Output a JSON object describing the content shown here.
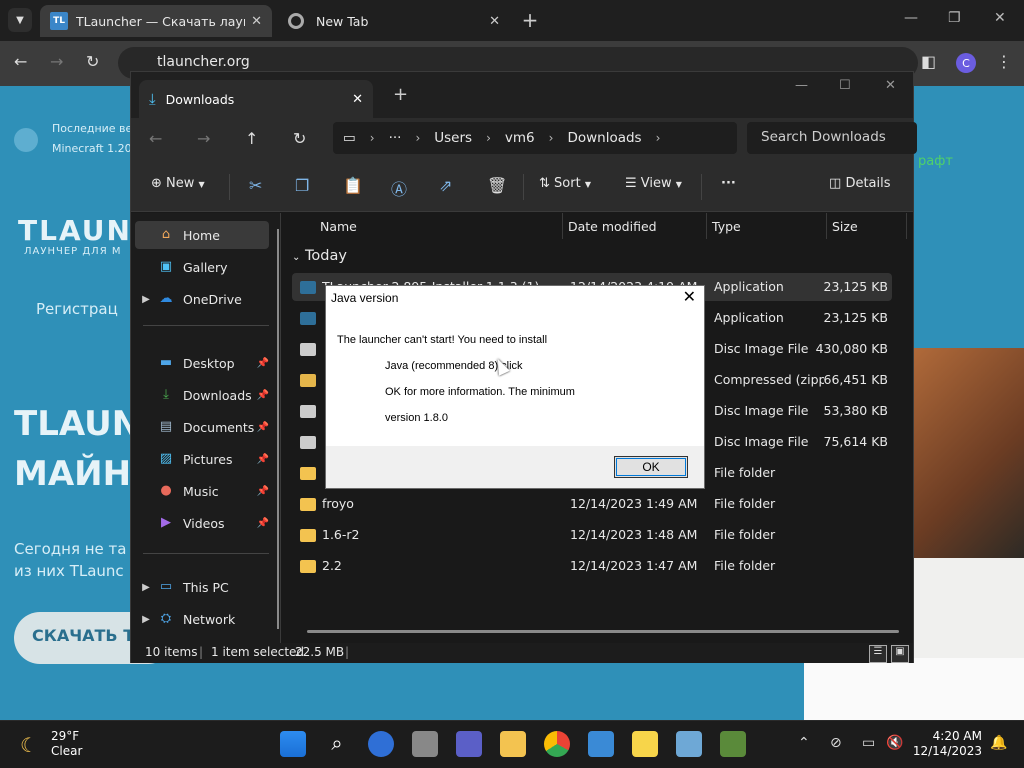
{
  "browser": {
    "tabs": [
      {
        "title": "TLauncher — Скачать лаунчер",
        "favicon": "TL",
        "active": true
      },
      {
        "title": "New Tab",
        "active": false
      }
    ],
    "url": "tlauncher.org",
    "profile_initial": "C"
  },
  "website": {
    "note_line1": "Последние ве",
    "note_line2": "Minecraft 1.20",
    "logo": "TLAUNC",
    "logo_sub": "ЛАУНЧЕР ДЛЯ М",
    "register": "Регистрац",
    "heading1": "TLAUN",
    "heading2": "МАЙН",
    "para1": "Сегодня не та",
    "para2": "из них TLaunc",
    "download_button": "СКАЧАТЬ Т",
    "right_label": "рафт"
  },
  "explorer": {
    "tab_title": "Downloads",
    "breadcrumb": [
      "Users",
      "vm6",
      "Downloads"
    ],
    "search_placeholder": "Search Downloads",
    "commands": {
      "new": "New",
      "sort": "Sort",
      "view": "View",
      "details": "Details"
    },
    "nav_items": [
      {
        "label": "Home",
        "selected": true
      },
      {
        "label": "Gallery"
      },
      {
        "label": "OneDrive",
        "expandable": true
      },
      {
        "label": "Desktop",
        "pinned": true
      },
      {
        "label": "Downloads",
        "pinned": true
      },
      {
        "label": "Documents",
        "pinned": true
      },
      {
        "label": "Pictures",
        "pinned": true
      },
      {
        "label": "Music",
        "pinned": true
      },
      {
        "label": "Videos",
        "pinned": true
      },
      {
        "label": "This PC",
        "expandable": true
      },
      {
        "label": "Network",
        "expandable": true
      }
    ],
    "columns": {
      "name": "Name",
      "date": "Date modified",
      "type": "Type",
      "size": "Size"
    },
    "group": "Today",
    "files": [
      {
        "name": "TLauncher-2.895-Installer-1.1.3 (1)",
        "date": "12/14/2023 4:19 AM",
        "type": "Application",
        "size": "23,125 KB",
        "icon": "app",
        "selected": true
      },
      {
        "name": "",
        "date": "",
        "type": "Application",
        "size": "23,125 KB",
        "icon": "app"
      },
      {
        "name": "",
        "date": "",
        "type": "Disc Image File",
        "size": "430,080 KB",
        "icon": "disc"
      },
      {
        "name": "",
        "date": "",
        "type": "Compressed (zipp...",
        "size": "66,451 KB",
        "icon": "zip"
      },
      {
        "name": "",
        "date": "",
        "type": "Disc Image File",
        "size": "53,380 KB",
        "icon": "disc"
      },
      {
        "name": "",
        "date": "",
        "type": "Disc Image File",
        "size": "75,614 KB",
        "icon": "disc"
      },
      {
        "name": "",
        "date": "",
        "type": "File folder",
        "size": "",
        "icon": "folder"
      },
      {
        "name": "froyo",
        "date": "12/14/2023 1:49 AM",
        "type": "File folder",
        "size": "",
        "icon": "folder"
      },
      {
        "name": "1.6-r2",
        "date": "12/14/2023 1:48 AM",
        "type": "File folder",
        "size": "",
        "icon": "folder"
      },
      {
        "name": "2.2",
        "date": "12/14/2023 1:47 AM",
        "type": "File folder",
        "size": "",
        "icon": "folder"
      }
    ],
    "status": {
      "count": "10 items",
      "selected": "1 item selected",
      "size": "22.5 MB"
    }
  },
  "dialog": {
    "title": "Java version",
    "lines": [
      "The launcher can't start! You need to install",
      "Java (recommended 8) click",
      "OK for more information. The minimum",
      "version 1.8.0"
    ],
    "ok": "OK"
  },
  "taskbar": {
    "weather_temp": "29°F",
    "weather_desc": "Clear",
    "time": "4:20 AM",
    "date": "12/14/2023"
  }
}
